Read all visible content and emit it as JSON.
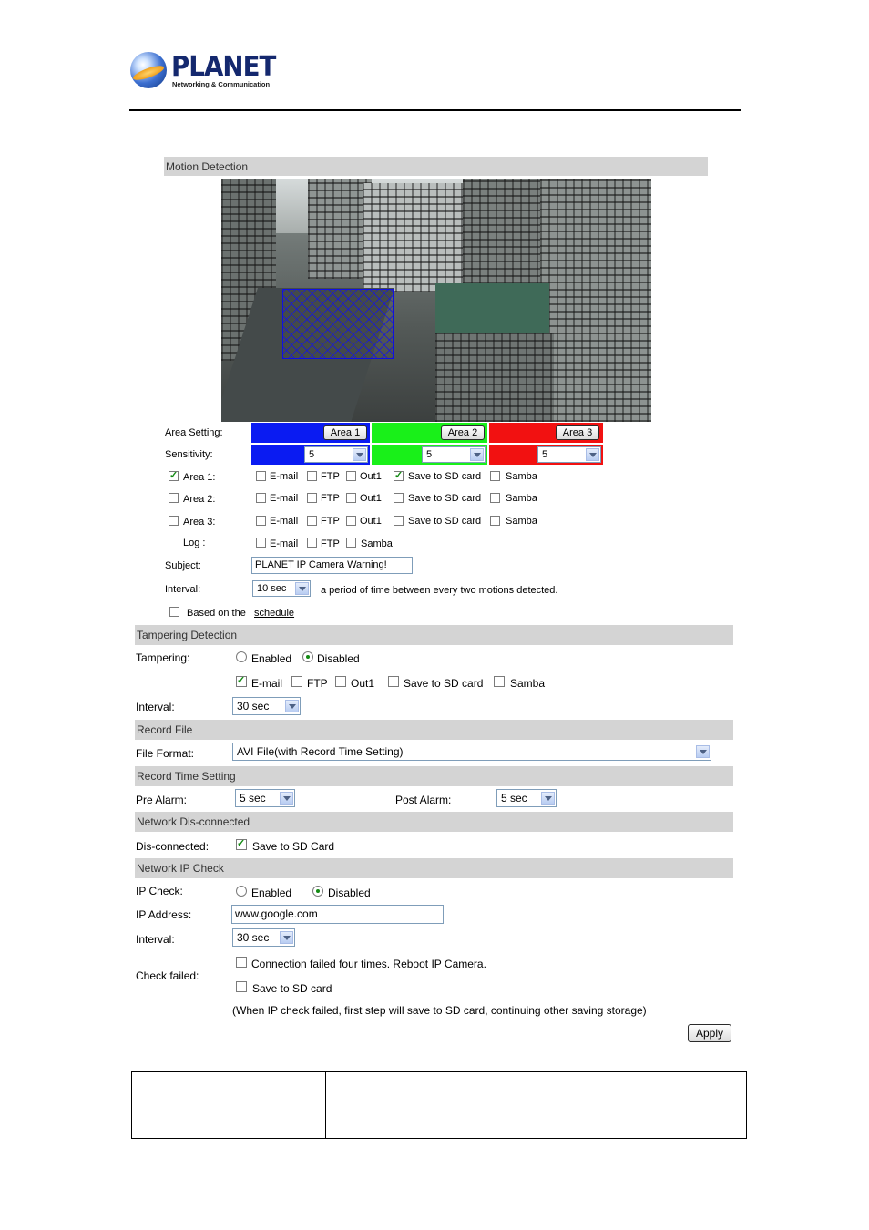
{
  "header": {
    "brand": "PLANET",
    "tagline": "Networking & Communication"
  },
  "motion": {
    "title": "Motion Detection",
    "area_setting_label": "Area Setting:",
    "sensitivity_label": "Sensitivity:",
    "areas": [
      {
        "button": "Area 1",
        "color": "#0a1bf2",
        "sensitivity": "5"
      },
      {
        "button": "Area 2",
        "color": "#19f019",
        "sensitivity": "5"
      },
      {
        "button": "Area 3",
        "color": "#f21111",
        "sensitivity": "5"
      }
    ],
    "rows": [
      {
        "label": "Area 1:",
        "checked": true,
        "email": "E-mail",
        "ftp": "FTP",
        "out1": "Out1",
        "sd": "Save to SD card",
        "samba": "Samba",
        "sd_checked": true
      },
      {
        "label": "Area 2:",
        "checked": false,
        "email": "E-mail",
        "ftp": "FTP",
        "out1": "Out1",
        "sd": "Save to SD card",
        "samba": "Samba",
        "sd_checked": false
      },
      {
        "label": "Area 3:",
        "checked": false,
        "email": "E-mail",
        "ftp": "FTP",
        "out1": "Out1",
        "sd": "Save to SD card",
        "samba": "Samba",
        "sd_checked": false
      }
    ],
    "log": {
      "label": "Log :",
      "email": "E-mail",
      "ftp": "FTP",
      "samba": "Samba"
    },
    "subject_label": "Subject:",
    "subject_value": "PLANET IP Camera Warning!",
    "interval_label": "Interval:",
    "interval_value": "10 sec",
    "interval_note": "a period of time between every two motions detected.",
    "schedule_prefix": "Based on the",
    "schedule_link": "schedule"
  },
  "tampering": {
    "title": "Tampering Detection",
    "label": "Tampering:",
    "enabled": "Enabled",
    "disabled": "Disabled",
    "email": "E-mail",
    "ftp": "FTP",
    "out1": "Out1",
    "sd": "Save to SD card",
    "samba": "Samba",
    "interval_label": "Interval:",
    "interval_value": "30 sec"
  },
  "record_file": {
    "title": "Record File",
    "format_label": "File Format:",
    "format_value": "AVI File(with Record Time Setting)"
  },
  "record_time": {
    "title": "Record Time Setting",
    "pre_label": "Pre Alarm:",
    "pre_value": "5 sec",
    "post_label": "Post Alarm:",
    "post_value": "5 sec"
  },
  "network_disconnected": {
    "title": "Network Dis-connected",
    "label": "Dis-connected:",
    "option": "Save to SD Card"
  },
  "ip_check": {
    "title": "Network IP Check",
    "label": "IP Check:",
    "enabled": "Enabled",
    "disabled": "Disabled",
    "address_label": "IP Address:",
    "address_value": "www.google.com",
    "interval_label": "Interval:",
    "interval_value": "30 sec",
    "failed_label": "Check failed:",
    "reboot_option": "Connection failed four times. Reboot IP Camera.",
    "sd_option": "Save to SD card",
    "note": "(When IP check failed, first step will save to SD card, continuing other saving storage)"
  },
  "apply_button": "Apply"
}
